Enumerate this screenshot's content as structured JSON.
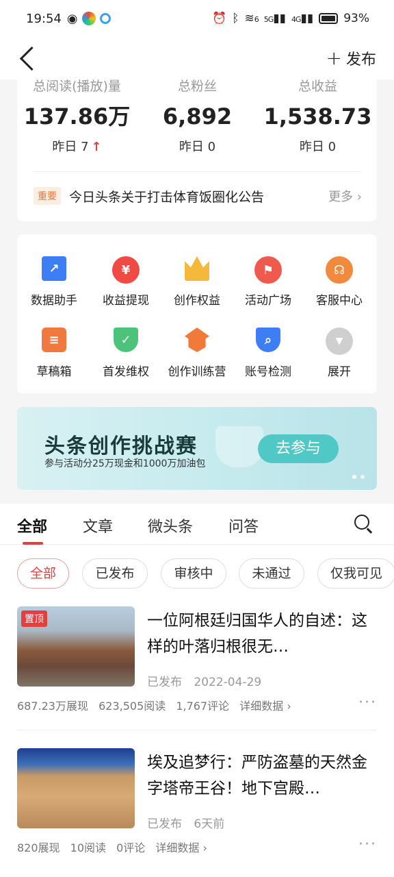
{
  "status_bar": {
    "time": "19:54",
    "battery": "93%",
    "sig_wifi": "6",
    "sig_5g": "5G",
    "sig_4g": "4G"
  },
  "nav": {
    "publish_plus": "+",
    "publish_label": "发布"
  },
  "stats": [
    {
      "label": "总阅读(播放)量",
      "value": "137.86万",
      "yesterday": "昨日 7",
      "trend": "↑"
    },
    {
      "label": "总粉丝",
      "value": "6,892",
      "yesterday": "昨日 0"
    },
    {
      "label": "总收益",
      "value": "1,538.73",
      "yesterday": "昨日 0"
    }
  ],
  "notice": {
    "badge": "重要",
    "text": "今日头条关于打击体育饭圈化公告",
    "more": "更多 ›"
  },
  "tools": [
    {
      "label": "数据助手",
      "icon": "chart-icon",
      "color": "#3d7ef5",
      "glyph": "↗"
    },
    {
      "label": "收益提现",
      "icon": "yuan-icon",
      "color": "#ef4a43",
      "glyph": "¥"
    },
    {
      "label": "创作权益",
      "icon": "crown-icon",
      "color": "#f4b93a",
      "glyph": "♛"
    },
    {
      "label": "活动广场",
      "icon": "flag-icon",
      "color": "#ef5a4f",
      "glyph": "⚑"
    },
    {
      "label": "客服中心",
      "icon": "headset-icon",
      "color": "#f28a3d",
      "glyph": "☊"
    },
    {
      "label": "草稿箱",
      "icon": "draft-icon",
      "color": "#f1793f",
      "glyph": "≡"
    },
    {
      "label": "首发维权",
      "icon": "shield-check-icon",
      "color": "#4cc27a",
      "glyph": "✓"
    },
    {
      "label": "创作训练营",
      "icon": "graduation-cap-icon",
      "color": "#f17a3a",
      "glyph": "▲"
    },
    {
      "label": "账号检测",
      "icon": "shield-search-icon",
      "color": "#3d7ef5",
      "glyph": "⌕"
    },
    {
      "label": "展开",
      "icon": "expand-icon",
      "color": "#c9c9c9",
      "glyph": "▼"
    }
  ],
  "banner": {
    "title": "头条创作挑战赛",
    "subtitle": "参与活动分25万现金和1000万加油包",
    "button": "去参与"
  },
  "tabs": [
    "全部",
    "文章",
    "微头条",
    "问答"
  ],
  "filters": [
    "全部",
    "已发布",
    "审核中",
    "未通过",
    "仅我可见"
  ],
  "posts": [
    {
      "pin": "置顶",
      "title": "一位阿根廷归国华人的自述：这样的叶落归根很无…",
      "status": "已发布",
      "date": "2022-04-29",
      "impressions": "687.23万展现",
      "reads": "623,505阅读",
      "comments": "1,767评论",
      "detail": "详细数据 ›"
    },
    {
      "title": "埃及追梦行：严防盗墓的天然金字塔帝王谷！地下宫殿…",
      "status": "已发布",
      "date": "6天前",
      "impressions": "820展现",
      "reads": "10阅读",
      "comments": "0评论",
      "detail": "详细数据 ›"
    }
  ],
  "more_dots": "···"
}
